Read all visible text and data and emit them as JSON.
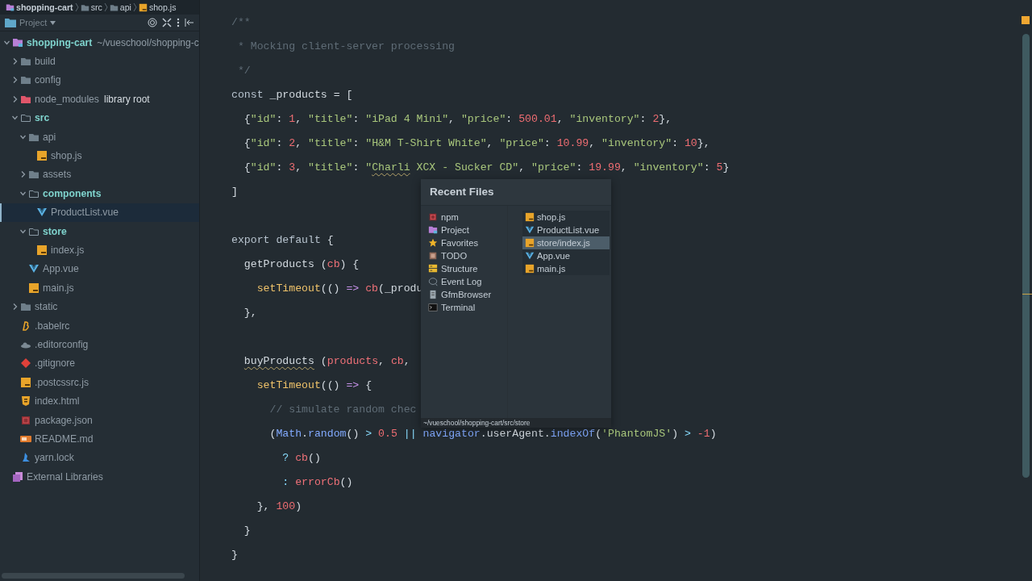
{
  "breadcrumb": [
    {
      "label": "shopping-cart",
      "kind": "project"
    },
    {
      "label": "src",
      "kind": "folder"
    },
    {
      "label": "api",
      "kind": "folder"
    },
    {
      "label": "shop.js",
      "kind": "js"
    }
  ],
  "project_panel": {
    "title": "Project",
    "tree": [
      {
        "label": "shopping-cart",
        "kind": "project",
        "path": "~/vueschool/shopping-c",
        "expanded": true,
        "modified": true,
        "selected": false,
        "children": [
          {
            "label": "build",
            "kind": "folder",
            "expanded": false,
            "modified": false,
            "selected": false
          },
          {
            "label": "config",
            "kind": "folder",
            "expanded": false,
            "modified": false,
            "selected": false
          },
          {
            "label": "node_modules",
            "kind": "folder-excluded",
            "badge": "library root",
            "expanded": false,
            "modified": false,
            "selected": false
          },
          {
            "label": "src",
            "kind": "folder-source",
            "expanded": true,
            "modified": true,
            "selected": false,
            "children": [
              {
                "label": "api",
                "kind": "folder",
                "expanded": true,
                "modified": false,
                "selected": false,
                "children": [
                  {
                    "label": "shop.js",
                    "kind": "js",
                    "modified": false,
                    "selected": false
                  }
                ]
              },
              {
                "label": "assets",
                "kind": "folder",
                "expanded": false,
                "modified": false,
                "selected": false
              },
              {
                "label": "components",
                "kind": "folder-source",
                "expanded": true,
                "modified": true,
                "selected": false,
                "children": [
                  {
                    "label": "ProductList.vue",
                    "kind": "vue",
                    "modified": false,
                    "selected": true
                  }
                ]
              },
              {
                "label": "store",
                "kind": "folder-source",
                "expanded": true,
                "modified": true,
                "selected": false,
                "children": [
                  {
                    "label": "index.js",
                    "kind": "js",
                    "modified": false,
                    "selected": false
                  }
                ]
              },
              {
                "label": "App.vue",
                "kind": "vue",
                "modified": false,
                "selected": false
              },
              {
                "label": "main.js",
                "kind": "js",
                "modified": false,
                "selected": false
              }
            ]
          },
          {
            "label": "static",
            "kind": "folder",
            "expanded": false,
            "modified": false,
            "selected": false
          },
          {
            "label": ".babelrc",
            "kind": "babel",
            "modified": false,
            "selected": false
          },
          {
            "label": ".editorconfig",
            "kind": "editorconfig",
            "modified": false,
            "selected": false
          },
          {
            "label": ".gitignore",
            "kind": "git",
            "modified": false,
            "selected": false
          },
          {
            "label": ".postcssrc.js",
            "kind": "js",
            "modified": false,
            "selected": false
          },
          {
            "label": "index.html",
            "kind": "html",
            "modified": false,
            "selected": false
          },
          {
            "label": "package.json",
            "kind": "npm",
            "modified": false,
            "selected": false
          },
          {
            "label": "README.md",
            "kind": "markdown",
            "modified": false,
            "selected": false
          },
          {
            "label": "yarn.lock",
            "kind": "yarn",
            "modified": false,
            "selected": false
          }
        ]
      },
      {
        "label": "External Libraries",
        "kind": "libraries",
        "modified": false,
        "selected": false
      }
    ]
  },
  "editor": {
    "lines": [
      {
        "kind": "code",
        "tokens": [
          {
            "kind": "comment",
            "text": "/**"
          }
        ]
      },
      {
        "kind": "code",
        "tokens": [
          {
            "kind": "comment",
            "text": " * Mocking client-server processing"
          }
        ]
      },
      {
        "kind": "code",
        "tokens": [
          {
            "kind": "comment",
            "text": " */"
          }
        ]
      },
      {
        "kind": "code",
        "tokens": [
          {
            "kind": "kw",
            "text": "const"
          },
          {
            "kind": "plain",
            "text": " _products = ["
          }
        ]
      },
      {
        "kind": "code",
        "tokens": [
          {
            "kind": "plain",
            "text": "  {"
          },
          {
            "kind": "str",
            "text": "\"id\""
          },
          {
            "kind": "plain",
            "text": ": "
          },
          {
            "kind": "num",
            "text": "1"
          },
          {
            "kind": "plain",
            "text": ", "
          },
          {
            "kind": "str",
            "text": "\"title\""
          },
          {
            "kind": "plain",
            "text": ": "
          },
          {
            "kind": "str",
            "text": "\"iPad 4 Mini\""
          },
          {
            "kind": "plain",
            "text": ", "
          },
          {
            "kind": "str",
            "text": "\"price\""
          },
          {
            "kind": "plain",
            "text": ": "
          },
          {
            "kind": "num",
            "text": "500.01"
          },
          {
            "kind": "plain",
            "text": ", "
          },
          {
            "kind": "str",
            "text": "\"inventory\""
          },
          {
            "kind": "plain",
            "text": ": "
          },
          {
            "kind": "num",
            "text": "2"
          },
          {
            "kind": "plain",
            "text": "},"
          }
        ]
      },
      {
        "kind": "code",
        "tokens": [
          {
            "kind": "plain",
            "text": "  {"
          },
          {
            "kind": "str",
            "text": "\"id\""
          },
          {
            "kind": "plain",
            "text": ": "
          },
          {
            "kind": "num",
            "text": "2"
          },
          {
            "kind": "plain",
            "text": ", "
          },
          {
            "kind": "str",
            "text": "\"title\""
          },
          {
            "kind": "plain",
            "text": ": "
          },
          {
            "kind": "str",
            "text": "\"H&M T-Shirt White\""
          },
          {
            "kind": "plain",
            "text": ", "
          },
          {
            "kind": "str",
            "text": "\"price\""
          },
          {
            "kind": "plain",
            "text": ": "
          },
          {
            "kind": "num",
            "text": "10.99"
          },
          {
            "kind": "plain",
            "text": ", "
          },
          {
            "kind": "str",
            "text": "\"inventory\""
          },
          {
            "kind": "plain",
            "text": ": "
          },
          {
            "kind": "num",
            "text": "10"
          },
          {
            "kind": "plain",
            "text": "},"
          }
        ]
      },
      {
        "kind": "code",
        "tokens": [
          {
            "kind": "plain",
            "text": "  {"
          },
          {
            "kind": "str",
            "text": "\"id\""
          },
          {
            "kind": "plain",
            "text": ": "
          },
          {
            "kind": "num",
            "text": "3"
          },
          {
            "kind": "plain",
            "text": ", "
          },
          {
            "kind": "str",
            "text": "\"title\""
          },
          {
            "kind": "plain",
            "text": ": "
          },
          {
            "kind": "str",
            "text": "\""
          },
          {
            "kind": "str-typo",
            "text": "Charli"
          },
          {
            "kind": "str",
            "text": " XCX - Sucker CD\""
          },
          {
            "kind": "plain",
            "text": ", "
          },
          {
            "kind": "str",
            "text": "\"price\""
          },
          {
            "kind": "plain",
            "text": ": "
          },
          {
            "kind": "num",
            "text": "19.99"
          },
          {
            "kind": "plain",
            "text": ", "
          },
          {
            "kind": "str",
            "text": "\"inventory\""
          },
          {
            "kind": "plain",
            "text": ": "
          },
          {
            "kind": "num",
            "text": "5"
          },
          {
            "kind": "plain",
            "text": "}"
          }
        ]
      },
      {
        "kind": "code",
        "tokens": [
          {
            "kind": "plain",
            "text": "]"
          }
        ]
      },
      {
        "kind": "blank"
      },
      {
        "kind": "code",
        "tokens": [
          {
            "kind": "kw",
            "text": "export default"
          },
          {
            "kind": "plain",
            "text": " {"
          }
        ]
      },
      {
        "kind": "code",
        "tokens": [
          {
            "kind": "plain",
            "text": "  getProducts ("
          },
          {
            "kind": "param",
            "text": "cb"
          },
          {
            "kind": "plain",
            "text": ") {"
          }
        ]
      },
      {
        "kind": "code",
        "tokens": [
          {
            "kind": "fn",
            "text": "    setTimeout"
          },
          {
            "kind": "plain",
            "text": "(() "
          },
          {
            "kind": "op",
            "text": "=>"
          },
          {
            "kind": "param",
            "text": " cb"
          },
          {
            "kind": "plain",
            "text": "(_produ"
          }
        ]
      },
      {
        "kind": "code",
        "tokens": [
          {
            "kind": "plain",
            "text": "  },"
          }
        ]
      },
      {
        "kind": "blank"
      },
      {
        "kind": "code",
        "tokens": [
          {
            "kind": "method-typo",
            "text": "  buyProducts"
          },
          {
            "kind": "plain",
            "text": " ("
          },
          {
            "kind": "param",
            "text": "products"
          },
          {
            "kind": "plain",
            "text": ", "
          },
          {
            "kind": "param",
            "text": "cb"
          },
          {
            "kind": "plain",
            "text": ", "
          }
        ]
      },
      {
        "kind": "code",
        "tokens": [
          {
            "kind": "fn",
            "text": "    setTimeout"
          },
          {
            "kind": "plain",
            "text": "(() "
          },
          {
            "kind": "op",
            "text": "=>"
          },
          {
            "kind": "plain",
            "text": " {"
          }
        ]
      },
      {
        "kind": "code",
        "tokens": [
          {
            "kind": "comment",
            "text": "      // simulate random chec"
          }
        ]
      },
      {
        "kind": "code",
        "tokens": [
          {
            "kind": "plain",
            "text": "      ("
          },
          {
            "kind": "obj",
            "text": "Math"
          },
          {
            "kind": "plain",
            "text": "."
          },
          {
            "kind": "obj",
            "text": "random"
          },
          {
            "kind": "plain",
            "text": "() "
          },
          {
            "kind": "cmp",
            "text": ">"
          },
          {
            "kind": "num",
            "text": " 0.5"
          },
          {
            "kind": "cmp",
            "text": " ||"
          },
          {
            "kind": "obj",
            "text": " navigator"
          },
          {
            "kind": "plain",
            "text": ".userAgent."
          },
          {
            "kind": "obj",
            "text": "indexOf"
          },
          {
            "kind": "plain",
            "text": "("
          },
          {
            "kind": "str",
            "text": "'PhantomJS'"
          },
          {
            "kind": "plain",
            "text": ") "
          },
          {
            "kind": "cmp",
            "text": ">"
          },
          {
            "kind": "num",
            "text": " -1"
          },
          {
            "kind": "plain",
            "text": ")"
          }
        ]
      },
      {
        "kind": "code",
        "tokens": [
          {
            "kind": "cmp",
            "text": "        ?"
          },
          {
            "kind": "param",
            "text": " cb"
          },
          {
            "kind": "plain",
            "text": "()"
          }
        ]
      },
      {
        "kind": "code",
        "tokens": [
          {
            "kind": "cmp",
            "text": "        :"
          },
          {
            "kind": "param",
            "text": " errorCb"
          },
          {
            "kind": "plain",
            "text": "()"
          }
        ]
      },
      {
        "kind": "code",
        "tokens": [
          {
            "kind": "plain",
            "text": "    }, "
          },
          {
            "kind": "num",
            "text": "100"
          },
          {
            "kind": "plain",
            "text": ")"
          }
        ]
      },
      {
        "kind": "code",
        "tokens": [
          {
            "kind": "plain",
            "text": "  }"
          }
        ]
      },
      {
        "kind": "code",
        "tokens": [
          {
            "kind": "plain",
            "text": "}"
          }
        ]
      }
    ]
  },
  "recent_files": {
    "title": "Recent Files",
    "tool_windows": [
      {
        "label": "npm",
        "kind": "npm"
      },
      {
        "label": "Project",
        "kind": "project"
      },
      {
        "label": "Favorites",
        "kind": "star"
      },
      {
        "label": "TODO",
        "kind": "todo"
      },
      {
        "label": "Structure",
        "kind": "structure"
      },
      {
        "label": "Event Log",
        "kind": "bubble"
      },
      {
        "label": "GfmBrowser",
        "kind": "document"
      },
      {
        "label": "Terminal",
        "kind": "terminal"
      }
    ],
    "files": [
      {
        "label": "shop.js",
        "kind": "js",
        "selected": false
      },
      {
        "label": "ProductList.vue",
        "kind": "vue",
        "selected": false
      },
      {
        "label": "store/index.js",
        "kind": "js",
        "selected": true
      },
      {
        "label": "App.vue",
        "kind": "vue",
        "selected": false
      },
      {
        "label": "main.js",
        "kind": "js",
        "selected": false
      }
    ],
    "path": "~/vueschool/shopping-cart/src/store"
  }
}
